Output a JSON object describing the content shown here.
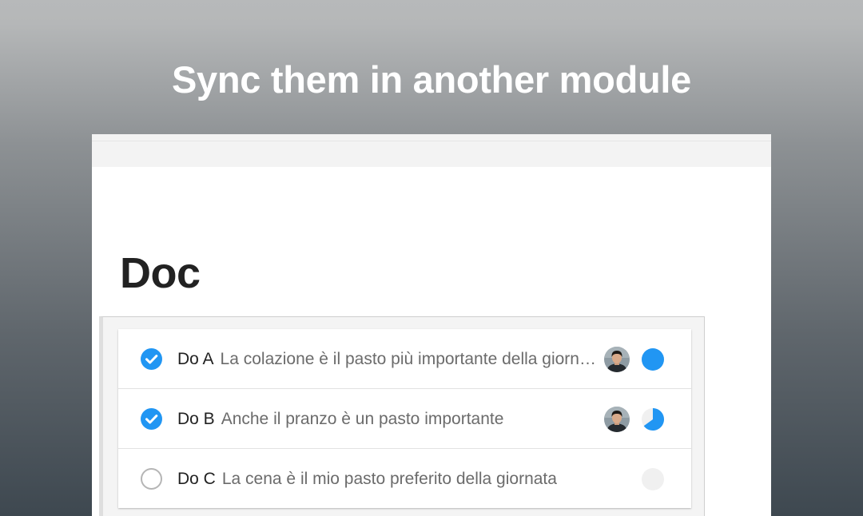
{
  "headline": "Sync them in another module",
  "doc": {
    "title": "Doc"
  },
  "tasks": [
    {
      "name": "Do A",
      "description": "La colazione è il pasto più importante della giornata",
      "completed": true,
      "progress": 1.0,
      "has_assignee": true,
      "check_icon": "checkmark-icon"
    },
    {
      "name": "Do B",
      "description": "Anche il pranzo è un pasto importante",
      "completed": true,
      "progress": 0.65,
      "has_assignee": true,
      "check_icon": "checkmark-icon"
    },
    {
      "name": "Do C",
      "description": "La cena è il mio pasto preferito della giornata",
      "completed": false,
      "progress": 0.0,
      "has_assignee": false,
      "check_icon": "empty-circle-icon"
    }
  ],
  "colors": {
    "accent": "#2196f3",
    "progress_empty": "#f0f0f0",
    "check_outline": "#b5b5b5"
  }
}
